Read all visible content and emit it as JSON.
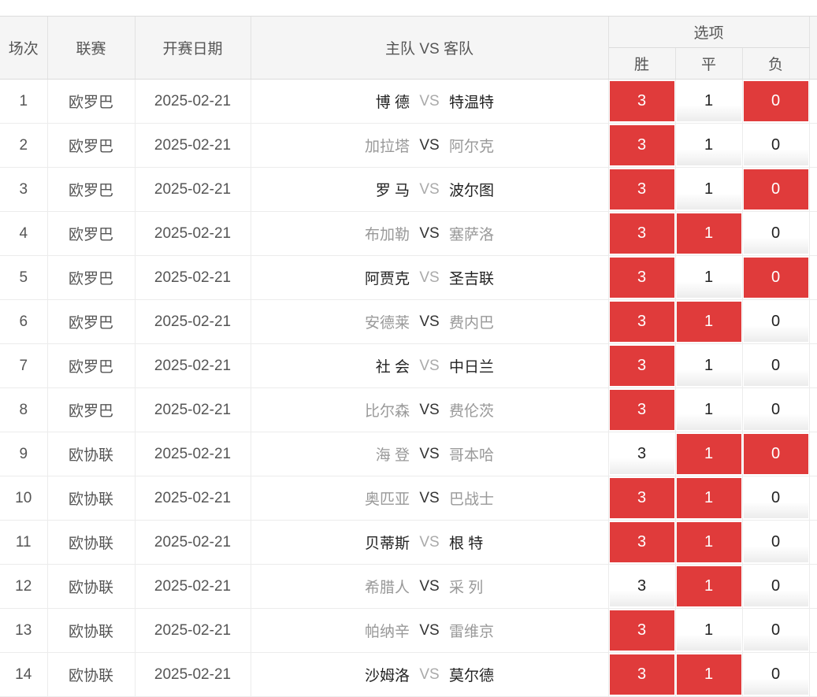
{
  "headers": {
    "index": "场次",
    "league": "联赛",
    "date": "开赛日期",
    "match": "主队 VS 客队",
    "options_group": "选项",
    "win": "胜",
    "draw": "平",
    "lose": "负"
  },
  "colors": {
    "selected": "#e03b3b",
    "unselected": "#ffffff"
  },
  "rows": [
    {
      "index": "1",
      "league": "欧罗巴",
      "date": "2025-02-21",
      "home": "博 德",
      "vs": "VS",
      "away": "特温特",
      "home_style": "dark",
      "vs_style": "gray",
      "away_style": "dark",
      "win": "3",
      "draw": "1",
      "lose": "0",
      "win_sel": true,
      "draw_sel": false,
      "lose_sel": true
    },
    {
      "index": "2",
      "league": "欧罗巴",
      "date": "2025-02-21",
      "home": "加拉塔",
      "vs": "VS",
      "away": "阿尔克",
      "home_style": "gray",
      "vs_style": "dark",
      "away_style": "gray",
      "win": "3",
      "draw": "1",
      "lose": "0",
      "win_sel": true,
      "draw_sel": false,
      "lose_sel": false
    },
    {
      "index": "3",
      "league": "欧罗巴",
      "date": "2025-02-21",
      "home": "罗 马",
      "vs": "VS",
      "away": "波尔图",
      "home_style": "dark",
      "vs_style": "gray",
      "away_style": "dark",
      "win": "3",
      "draw": "1",
      "lose": "0",
      "win_sel": true,
      "draw_sel": false,
      "lose_sel": true
    },
    {
      "index": "4",
      "league": "欧罗巴",
      "date": "2025-02-21",
      "home": "布加勒",
      "vs": "VS",
      "away": "塞萨洛",
      "home_style": "gray",
      "vs_style": "dark",
      "away_style": "gray",
      "win": "3",
      "draw": "1",
      "lose": "0",
      "win_sel": true,
      "draw_sel": true,
      "lose_sel": false
    },
    {
      "index": "5",
      "league": "欧罗巴",
      "date": "2025-02-21",
      "home": "阿贾克",
      "vs": "VS",
      "away": "圣吉联",
      "home_style": "dark",
      "vs_style": "gray",
      "away_style": "dark",
      "win": "3",
      "draw": "1",
      "lose": "0",
      "win_sel": true,
      "draw_sel": false,
      "lose_sel": true
    },
    {
      "index": "6",
      "league": "欧罗巴",
      "date": "2025-02-21",
      "home": "安德莱",
      "vs": "VS",
      "away": "费内巴",
      "home_style": "gray",
      "vs_style": "dark",
      "away_style": "gray",
      "win": "3",
      "draw": "1",
      "lose": "0",
      "win_sel": true,
      "draw_sel": true,
      "lose_sel": false
    },
    {
      "index": "7",
      "league": "欧罗巴",
      "date": "2025-02-21",
      "home": "社 会",
      "vs": "VS",
      "away": "中日兰",
      "home_style": "dark",
      "vs_style": "gray",
      "away_style": "dark",
      "win": "3",
      "draw": "1",
      "lose": "0",
      "win_sel": true,
      "draw_sel": false,
      "lose_sel": false
    },
    {
      "index": "8",
      "league": "欧罗巴",
      "date": "2025-02-21",
      "home": "比尔森",
      "vs": "VS",
      "away": "费伦茨",
      "home_style": "gray",
      "vs_style": "dark",
      "away_style": "gray",
      "win": "3",
      "draw": "1",
      "lose": "0",
      "win_sel": true,
      "draw_sel": false,
      "lose_sel": false
    },
    {
      "index": "9",
      "league": "欧协联",
      "date": "2025-02-21",
      "home": "海 登",
      "vs": "VS",
      "away": "哥本哈",
      "home_style": "gray",
      "vs_style": "dark",
      "away_style": "gray",
      "win": "3",
      "draw": "1",
      "lose": "0",
      "win_sel": false,
      "draw_sel": true,
      "lose_sel": true
    },
    {
      "index": "10",
      "league": "欧协联",
      "date": "2025-02-21",
      "home": "奥匹亚",
      "vs": "VS",
      "away": "巴战士",
      "home_style": "gray",
      "vs_style": "dark",
      "away_style": "gray",
      "win": "3",
      "draw": "1",
      "lose": "0",
      "win_sel": true,
      "draw_sel": true,
      "lose_sel": false
    },
    {
      "index": "11",
      "league": "欧协联",
      "date": "2025-02-21",
      "home": "贝蒂斯",
      "vs": "VS",
      "away": "根 特",
      "home_style": "dark",
      "vs_style": "gray",
      "away_style": "dark",
      "win": "3",
      "draw": "1",
      "lose": "0",
      "win_sel": true,
      "draw_sel": true,
      "lose_sel": false
    },
    {
      "index": "12",
      "league": "欧协联",
      "date": "2025-02-21",
      "home": "希腊人",
      "vs": "VS",
      "away": "采 列",
      "home_style": "gray",
      "vs_style": "dark",
      "away_style": "gray",
      "win": "3",
      "draw": "1",
      "lose": "0",
      "win_sel": false,
      "draw_sel": true,
      "lose_sel": false
    },
    {
      "index": "13",
      "league": "欧协联",
      "date": "2025-02-21",
      "home": "帕纳辛",
      "vs": "VS",
      "away": "雷维京",
      "home_style": "gray",
      "vs_style": "dark",
      "away_style": "gray",
      "win": "3",
      "draw": "1",
      "lose": "0",
      "win_sel": true,
      "draw_sel": false,
      "lose_sel": false
    },
    {
      "index": "14",
      "league": "欧协联",
      "date": "2025-02-21",
      "home": "沙姆洛",
      "vs": "VS",
      "away": "莫尔德",
      "home_style": "dark",
      "vs_style": "gray",
      "away_style": "dark",
      "win": "3",
      "draw": "1",
      "lose": "0",
      "win_sel": true,
      "draw_sel": true,
      "lose_sel": false
    }
  ]
}
